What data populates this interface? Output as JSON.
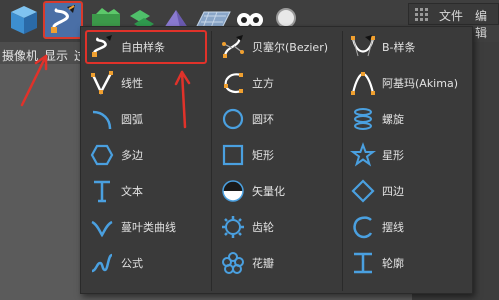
{
  "toolbar": {
    "menu_file": "文件",
    "menu_edit": "编辑",
    "tools": [
      "cube-tool",
      "spline-tool",
      "generator-tool",
      "deformer-tool",
      "plane-tool",
      "infinity-tool",
      "light-tool"
    ]
  },
  "subbar": {
    "camera": "摄像机",
    "display": "显示",
    "cut": "过"
  },
  "menu": {
    "col1": [
      {
        "label": "自由样条",
        "icon": "freehand-spline-icon"
      },
      {
        "label": "线性",
        "icon": "linear-spline-icon"
      },
      {
        "label": "圆弧",
        "icon": "arc-icon"
      },
      {
        "label": "多边",
        "icon": "hexagon-icon"
      },
      {
        "label": "文本",
        "icon": "text-icon"
      },
      {
        "label": "蔓叶类曲线",
        "icon": "cissoid-icon"
      },
      {
        "label": "公式",
        "icon": "formula-icon"
      }
    ],
    "col2": [
      {
        "label": "贝塞尔(Bezier)",
        "icon": "bezier-icon"
      },
      {
        "label": "立方",
        "icon": "cubic-icon"
      },
      {
        "label": "圆环",
        "icon": "circle-icon"
      },
      {
        "label": "矩形",
        "icon": "rectangle-icon"
      },
      {
        "label": "矢量化",
        "icon": "vectorizer-icon"
      },
      {
        "label": "齿轮",
        "icon": "cogwheel-icon"
      },
      {
        "label": "花瓣",
        "icon": "flower-icon"
      }
    ],
    "col3": [
      {
        "label": "B-样条",
        "icon": "b-spline-icon"
      },
      {
        "label": "阿基玛(Akima)",
        "icon": "akima-icon"
      },
      {
        "label": "螺旋",
        "icon": "helix-icon"
      },
      {
        "label": "星形",
        "icon": "star-icon"
      },
      {
        "label": "四边",
        "icon": "four-side-icon"
      },
      {
        "label": "摆线",
        "icon": "cycloid-icon"
      },
      {
        "label": "轮廓",
        "icon": "profile-icon"
      }
    ]
  },
  "colors": {
    "accent_blue": "#4aa0e0",
    "highlight_red": "#e0322a",
    "point_orange": "#f0a030"
  }
}
